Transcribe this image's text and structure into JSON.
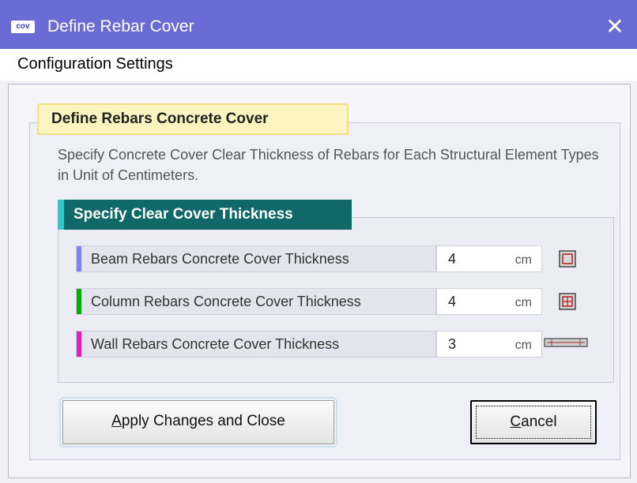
{
  "window": {
    "icon_label": "cov",
    "title": "Define Rebar Cover",
    "close_glyph": "✕"
  },
  "menu": {
    "items": [
      {
        "label": "Configuration Settings"
      }
    ]
  },
  "group_main": {
    "title": "Define Rebars Concrete Cover",
    "description": "Specify Concrete Cover Clear Thickness of Rebars for Each Structural Element Types in Unit of Centimeters."
  },
  "group_thickness": {
    "title": "Specify Clear Cover Thickness",
    "rows": [
      {
        "label": "Beam Rebars Concrete Cover Thickness",
        "value": "4",
        "unit": "cm",
        "bar_color": "#8080ff",
        "icon": "beam-section-icon"
      },
      {
        "label": "Column Rebars Concrete Cover Thickness",
        "value": "4",
        "unit": "cm",
        "bar_color": "#00b000",
        "icon": "column-section-icon"
      },
      {
        "label": "Wall Rebars Concrete Cover Thickness",
        "value": "3",
        "unit": "cm",
        "bar_color": "#e020c0",
        "icon": "wall-section-icon"
      }
    ]
  },
  "buttons": {
    "apply": {
      "prefix": "",
      "mnemonic": "A",
      "rest": "pply Changes and Close"
    },
    "cancel": {
      "prefix": "",
      "mnemonic": "C",
      "rest": "ancel"
    }
  },
  "colors": {
    "titlebar": "#6b6bd6",
    "group_tab_yellow": "#fbf4c0",
    "group_tab_teal": "#106868"
  }
}
